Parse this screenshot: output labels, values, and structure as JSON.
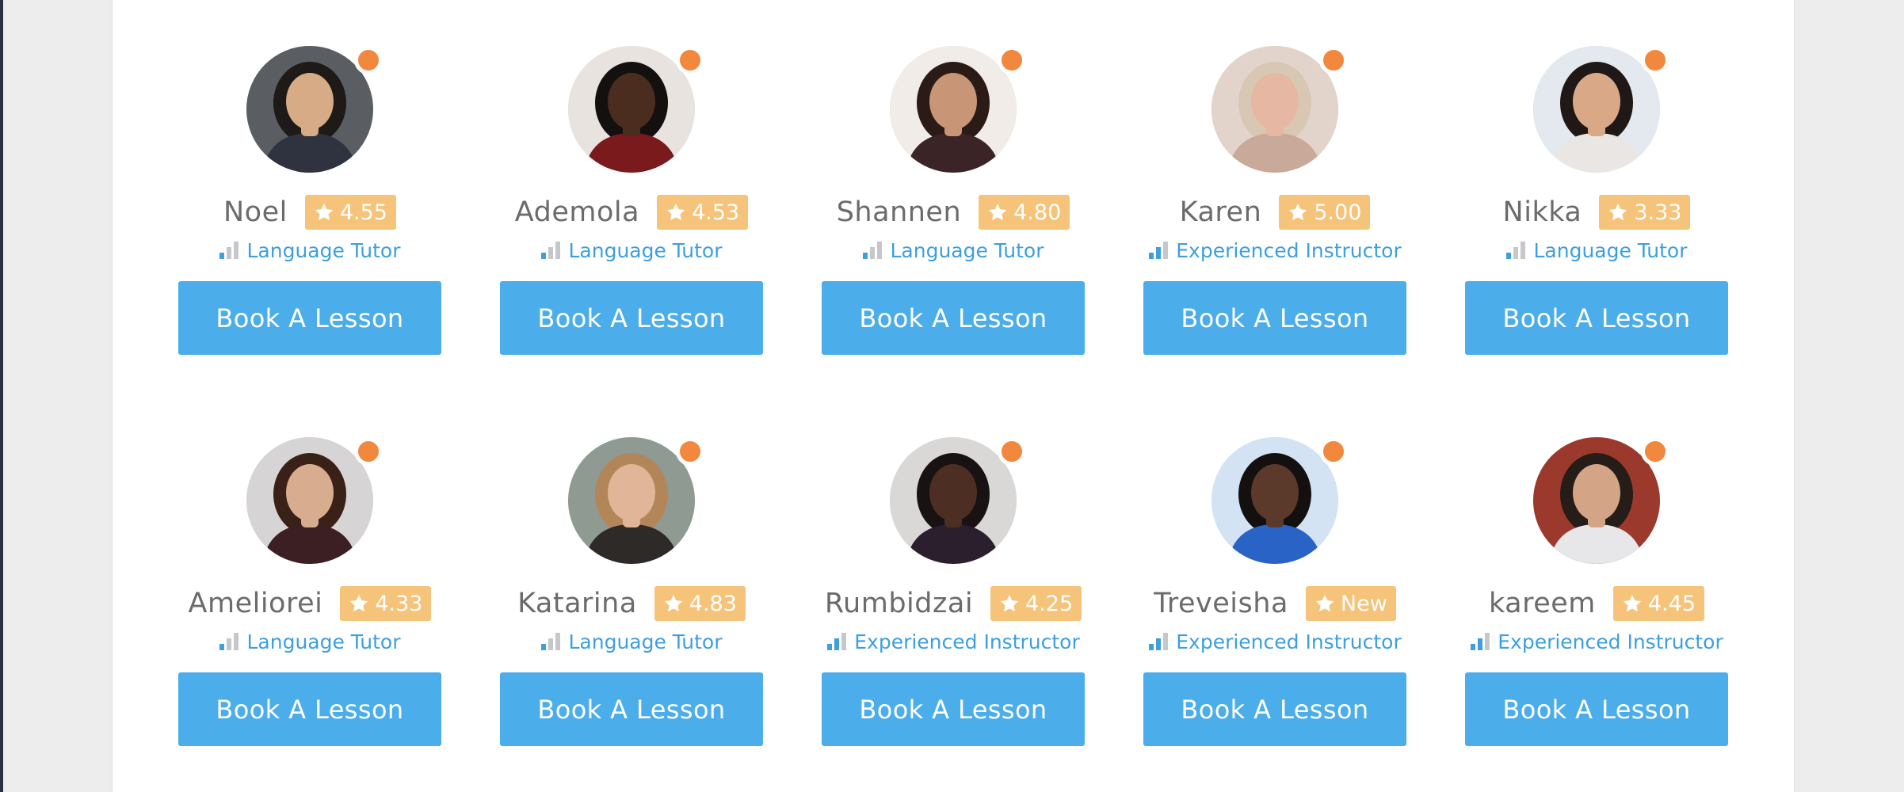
{
  "colors": {
    "background": "#ededed",
    "panel": "#ffffff",
    "sidebar_edge": "#26323f",
    "status_dot": "#f2883d",
    "rating_badge": "#f6c37a",
    "primary_button": "#4badea",
    "level_text": "#3d9fdf",
    "name_text": "#6b6b6b"
  },
  "icons": {
    "rating": "star-icon",
    "level": "level-bars-icon",
    "status": "online-status-dot"
  },
  "tutors": [
    {
      "name": "Noel",
      "rating": "4.55",
      "level": "Language Tutor",
      "level_bars": 1,
      "button": "Book A Lesson",
      "avatar_bg": "#5a5d62",
      "skin": "#d7ab85",
      "hair": "#1d1a18",
      "shirt": "#2f3340"
    },
    {
      "name": "Ademola",
      "rating": "4.53",
      "level": "Language Tutor",
      "level_bars": 1,
      "button": "Book A Lesson",
      "avatar_bg": "#e8e3df",
      "skin": "#4a2d1f",
      "hair": "#141010",
      "shirt": "#7a1a1d"
    },
    {
      "name": "Shannen",
      "rating": "4.80",
      "level": "Language Tutor",
      "level_bars": 1,
      "button": "Book A Lesson",
      "avatar_bg": "#f1ece8",
      "skin": "#c89576",
      "hair": "#2b1b16",
      "shirt": "#3a2426"
    },
    {
      "name": "Karen",
      "rating": "5.00",
      "level": "Experienced Instructor",
      "level_bars": 2,
      "button": "Book A Lesson",
      "avatar_bg": "#e2d4ca",
      "skin": "#e6b7a2",
      "hair": "#d8c7b3",
      "shirt": "#c9a999"
    },
    {
      "name": "Nikka",
      "rating": "3.33",
      "level": "Language Tutor",
      "level_bars": 1,
      "button": "Book A Lesson",
      "avatar_bg": "#e4e8ef",
      "skin": "#d9a987",
      "hair": "#1f1816",
      "shirt": "#e9e6e4"
    },
    {
      "name": "Ameliorei",
      "rating": "4.33",
      "level": "Language Tutor",
      "level_bars": 1,
      "button": "Book A Lesson",
      "avatar_bg": "#d6d4d4",
      "skin": "#d8ad8f",
      "hair": "#3a2118",
      "shirt": "#3c1f22"
    },
    {
      "name": "Katarina",
      "rating": "4.83",
      "level": "Language Tutor",
      "level_bars": 1,
      "button": "Book A Lesson",
      "avatar_bg": "#8f9a93",
      "skin": "#e0b598",
      "hair": "#b3865a",
      "shirt": "#2d2a28"
    },
    {
      "name": "Rumbidzai",
      "rating": "4.25",
      "level": "Experienced Instructor",
      "level_bars": 2,
      "button": "Book A Lesson",
      "avatar_bg": "#d9d8d6",
      "skin": "#4d2e22",
      "hair": "#181212",
      "shirt": "#2b1f2d"
    },
    {
      "name": "Treveisha",
      "rating": "New",
      "level": "Experienced Instructor",
      "level_bars": 2,
      "button": "Book A Lesson",
      "avatar_bg": "#d3e3f4",
      "skin": "#5b3a2c",
      "hair": "#151010",
      "shirt": "#2a63c6"
    },
    {
      "name": "kareem",
      "rating": "4.45",
      "level": "Experienced Instructor",
      "level_bars": 2,
      "button": "Book A Lesson",
      "avatar_bg": "#9b3a2c",
      "skin": "#d3a485",
      "hair": "#261c18",
      "shirt": "#e7e7ea"
    }
  ]
}
